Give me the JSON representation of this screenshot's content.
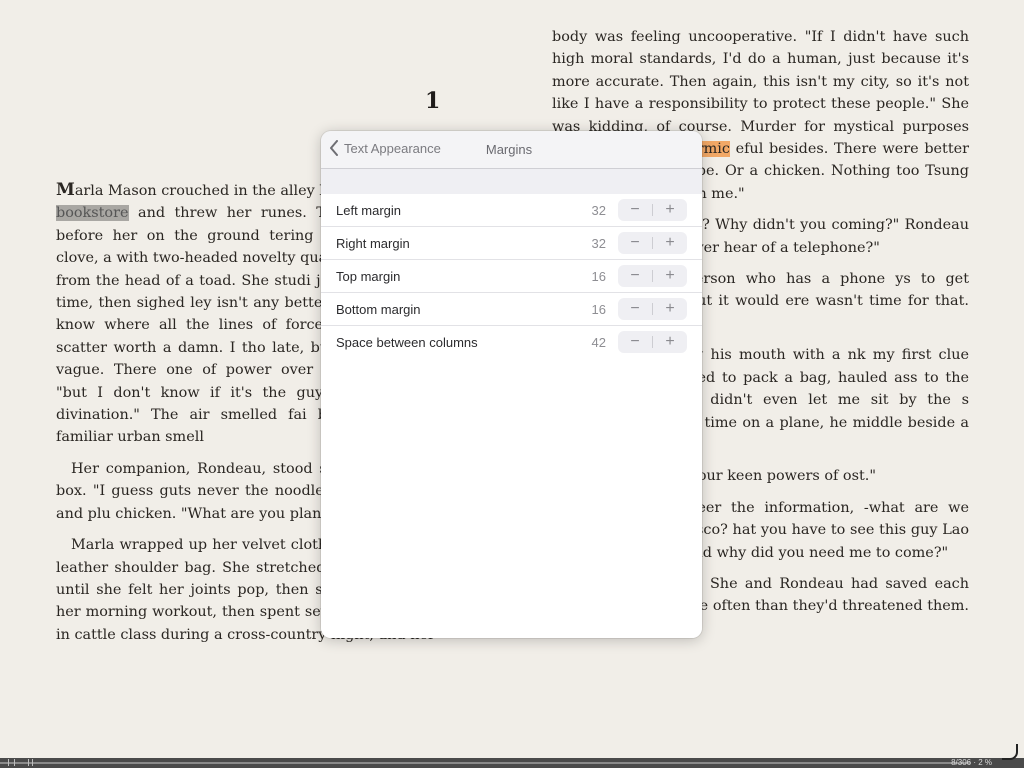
{
  "book": {
    "chapter_number": "1",
    "left_column": {
      "p1_dropcap": "M",
      "p1_before_highlight": "arla Mason crouched in the alley be",
      "p1_highlight": "bookstore",
      "p1_after_highlight": " and threw her runes. The s velvet spread before her on the ground tering of objects—a garlic clove, a with two-headed novelty quarter, fingernai stone from the head of a toad. She studi jects made for a long time, then sighed ley isn't any better than the other two know where all the lines of force are in terpret the scatter worth a damn. I tho late, but even then it's too vague. There one of power over there\"—she gesture \"but I don't know if it's the guy we're l do a wet divination.\" The air smelled fai but not even those familiar urban smell",
      "p2": "Her companion, Rondeau, stood slurp a waxed-paper box. \"I guess guts never the noodles with his chopstick and plu chicken. \"What are you planning to evis",
      "p3": "Marla wrapped up her velvet cloth a stowed them in a leather shoulder bag. She stretched her arms overhead until she felt her joints pop, then sighed. She'd missed her morning workout, then spent several hours cramped in cattle class during a cross-country flight, and her"
    },
    "right_column": {
      "p1_before_highlight": "body was feeling uncooperative. \"If I didn't have such high moral standards, I'd do a human, just because it's more accurate. Then again, this isn't my city, so it's not like I have a responsibility to protect these people.\" She was kidding, of course. Murder for mystical purposes incurred a nasty",
      "p1_highlight": "karmic",
      "p1_after_highlight": "eful besides. There were better uses for A cat, maybe. Or a chicken. Nothing too Tsung is trying to hide from me.\"",
      "p2": "look for him anyway? Why didn't you coming?\" Rondeau wiggled his fingers ver hear of a telephone?\"",
      "p3": "not the kind of person who has a phone ys to get messages to him, but it would ere wasn't time for that. I'm in a hurry.\"",
      "p4": "ondeau said, wiping his mouth with a nk my first clue was when you busted to pack a bag, hauled ass to the airport, plane. You didn't even let me sit by the s aggrieved. \"My first time on a plane, he middle beside a fat guy with sweat",
      "p5": "at, too? I think it's your keen powers of ost.\"",
      "p6": "oping you'd volunteer the information, -what are we doing in San Francisco? hat you have to see this guy Lao Tsung right now? And why did you need me to come?\"",
      "p7": "Marla considered. She and Rondeau had saved each other's lives far more often than they'd threatened them. Keeping se-"
    }
  },
  "popover": {
    "back_label": "Text Appearance",
    "title": "Margins",
    "rows": [
      {
        "label": "Left margin",
        "value": "32"
      },
      {
        "label": "Right margin",
        "value": "32"
      },
      {
        "label": "Top margin",
        "value": "16"
      },
      {
        "label": "Bottom margin",
        "value": "16"
      },
      {
        "label": "Space between columns",
        "value": "42"
      }
    ],
    "minus_glyph": "−",
    "plus_glyph": "+"
  },
  "scrubber": {
    "page_count": "8/306 · 2 %"
  },
  "colors": {
    "page_background": "#f1eee8",
    "highlight_gray": "#a9a7a3",
    "highlight_orange": "#f2a866",
    "popover_background": "#efeff3"
  },
  "icons": {
    "back": "chevron-left-icon"
  }
}
